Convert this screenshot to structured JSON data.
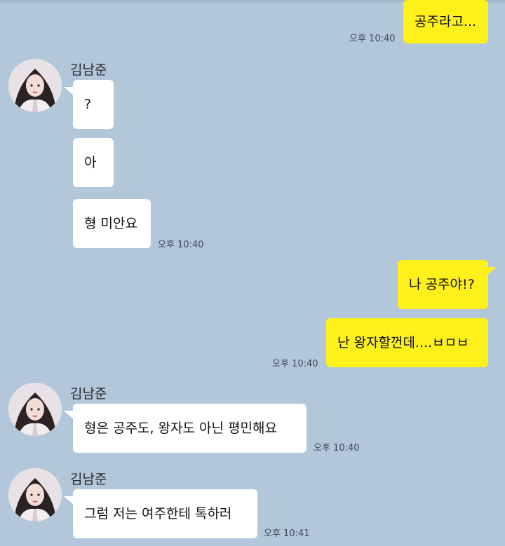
{
  "colors": {
    "background": "#b2c7da",
    "incoming": "#ffffff",
    "outgoing": "#fef01b"
  },
  "sender_name": "김남준",
  "messages": [
    {
      "from": "me",
      "text": "공주라고...",
      "time": "오후 10:40"
    },
    {
      "from": "them",
      "text": "?"
    },
    {
      "from": "them",
      "text": "아"
    },
    {
      "from": "them",
      "text": "형 미안요",
      "time": "오후 10:40"
    },
    {
      "from": "me",
      "text": "나 공주야!?"
    },
    {
      "from": "me",
      "text": "난 왕자할껀데....ㅂㅁㅂ",
      "time": "오후 10:40"
    },
    {
      "from": "them",
      "text": "형은 공주도, 왕자도 아닌 평민해요",
      "time": "오후 10:40"
    },
    {
      "from": "them",
      "text": "그럼 저는 여주한테 톡하러",
      "time": "오후 10:41"
    }
  ]
}
